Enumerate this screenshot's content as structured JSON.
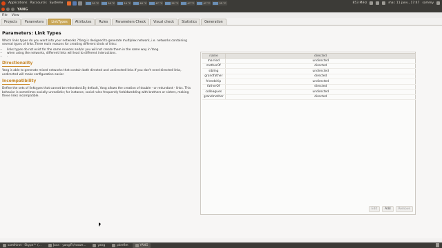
{
  "topbar": {
    "menus": [
      "Applications",
      "Raccourcis",
      "Système"
    ],
    "sensors": [
      "50 °C",
      "56 °C",
      "54 °C",
      "46 °C",
      "47 °C",
      "52 °C",
      "47 °C",
      "47 °C",
      "52 °C"
    ],
    "network": "853 MiHz",
    "clock": "mar. 11 janv., 17:47",
    "user": "sammy"
  },
  "window": {
    "title": "YANG"
  },
  "menubar": {
    "items": [
      "File",
      "View"
    ]
  },
  "tabs": [
    {
      "label": "Projects"
    },
    {
      "label": "Parameters"
    },
    {
      "label": "LinkTypes"
    },
    {
      "label": "Attributes"
    },
    {
      "label": "Rules"
    },
    {
      "label": "Parameters Check"
    },
    {
      "label": "Visual check"
    },
    {
      "label": "Statistics"
    },
    {
      "label": "Generation"
    }
  ],
  "main": {
    "heading": "Parameters: Link Types",
    "intro": "Which links types do you want into your networks ?Yang is designed to generate multiplex network, i.e. networks containing several types of links.Three main reasons for creating different kinds of links:",
    "bullets": [
      "links types do not exist for the same reasons and/or you will not create them in the same way in Yang.",
      "when using the networks, different links will lead to different interactions.",
      "."
    ],
    "section1_title": "Directionality",
    "section1_text": "Yang is able to generate mixed networks that contain both directed and undirected links.If you don't need directed links, undirected will make configuration easier.",
    "section2_title": "Incompatibility",
    "section2_text": "Define the sets of linktypes that cannot be redondant.By default, Yang allows the creation of double - or redundant - links. This behavior is sometimes socially unrealistic; for instance, social rules frequently forbidwedding with brothers or sisters, making these links incompatible."
  },
  "table": {
    "headers": [
      "name",
      "directed"
    ],
    "rows": [
      {
        "name": "married",
        "directed": "undirected"
      },
      {
        "name": "motherOf",
        "directed": "directed"
      },
      {
        "name": "sibling",
        "directed": "undirected"
      },
      {
        "name": "grandfather",
        "directed": "directed"
      },
      {
        "name": "friendship",
        "directed": "undirected"
      },
      {
        "name": "fatherOf",
        "directed": "directed"
      },
      {
        "name": "colleagues",
        "directed": "undirected"
      },
      {
        "name": "grandmother",
        "directed": "directed"
      }
    ],
    "buttons": {
      "edit": "Edit",
      "add": "Add",
      "remove": "Remove"
    }
  },
  "taskbar": {
    "items": [
      {
        "label": "samlhirot - Skype™ (..."
      },
      {
        "label": "Java - yang/Fr/roswe..."
      },
      {
        "label": "yang"
      },
      {
        "label": "pkrefim"
      },
      {
        "label": "YANG"
      }
    ]
  },
  "colors": {
    "active_tab": "#c9a656",
    "section_title": "#c9892a",
    "panel_bg": "#3c3b37"
  }
}
